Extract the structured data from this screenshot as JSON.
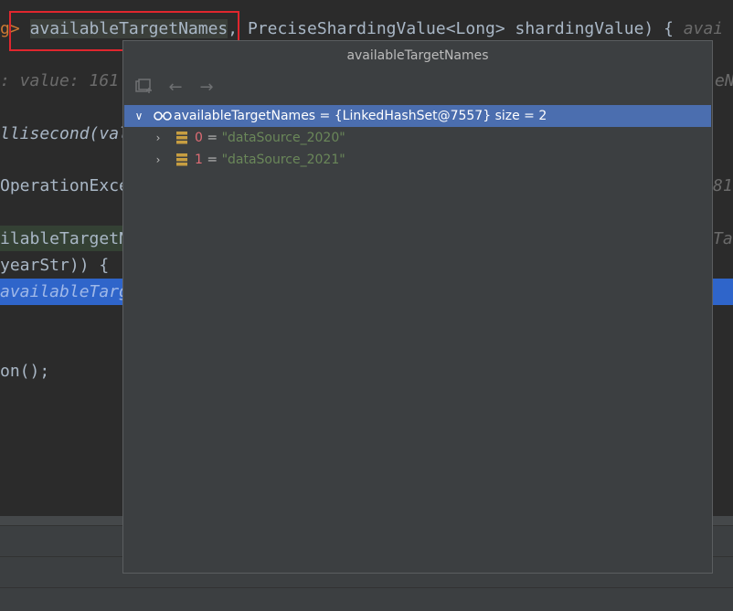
{
  "editor": {
    "lines": [
      {
        "segments": [
          {
            "text": "g>",
            "cls": "kw"
          },
          {
            "text": " "
          },
          {
            "text": "availableTargetNames",
            "cls": "hl-word"
          },
          {
            "text": ", PreciseShardingValue<Long> shardingValue) {  "
          },
          {
            "text": "avai",
            "cls": "hint"
          }
        ]
      },
      {
        "segments": [
          {
            "text": ":  value: 161",
            "cls": "hint"
          }
        ]
      },
      {
        "segments": [
          {
            "text": "llisecond(val",
            "cls": "italic"
          }
        ]
      },
      {
        "segments": [
          {
            "text": "OperationExce"
          }
        ]
      },
      {
        "segments": [
          {
            "text": "ilableTargetN"
          }
        ]
      },
      {
        "segments": [
          {
            "text": "yearStr)) {"
          }
        ]
      },
      {
        "segments": [
          {
            "text": "availableTarge",
            "cls": "hint"
          }
        ]
      },
      {
        "segments": [
          {
            "text": "on();"
          }
        ]
      }
    ],
    "right_fragments": [
      "eNa",
      "81",
      "Tar"
    ]
  },
  "popup": {
    "title": "availableTargetNames",
    "toolbar": {
      "back_icon": "←",
      "forward_icon": "→"
    },
    "root": {
      "name": "availableTargetNames",
      "value": " = {LinkedHashSet@7557}  size = 2"
    },
    "children": [
      {
        "index": "0",
        "eq": " = ",
        "value": "\"dataSource_2020\""
      },
      {
        "index": "1",
        "eq": " = ",
        "value": "\"dataSource_2021\""
      }
    ]
  },
  "colors": {
    "highlight_box": "#e0262e",
    "selection": "#4b6eaf",
    "string": "#6a8759",
    "index": "#e06c75"
  }
}
